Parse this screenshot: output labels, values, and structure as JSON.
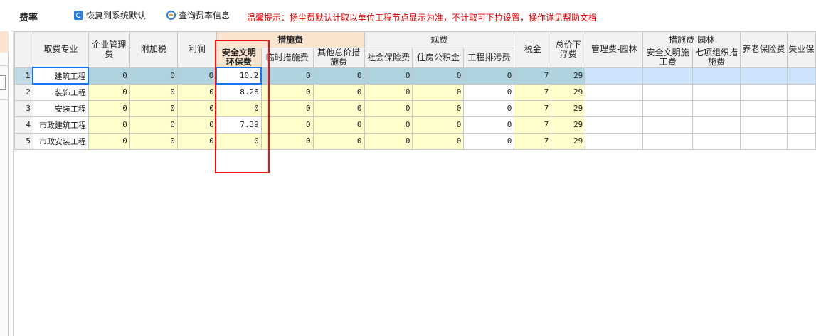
{
  "toolbar": {
    "title": "费率",
    "restore_label": "恢复到系统默认",
    "query_label": "查询费率信息",
    "tip": "温馨提示：扬尘费默认计取以单位工程节点显示为准，不计取可下拉设置，操作详见帮助文档"
  },
  "headers": {
    "profession": "取费专业",
    "mgmt": "企业管理费",
    "surtax": "附加税",
    "profit": "利润",
    "measures_group": "措施费",
    "safety": "安全文明环保费",
    "temp": "临时措施费",
    "other_total": "其他总价措施费",
    "regulation_group": "规费",
    "social": "社会保险费",
    "housing": "住房公积金",
    "sewage": "工程排污费",
    "tax": "税金",
    "float": "总价下浮费",
    "mgmt_garden": "管理费-园林",
    "garden_group": "措施费-园林",
    "safety_garden": "安全文明施工费",
    "seven_items": "七项组织措施费",
    "pension": "养老保险费",
    "unemployment": "失业保"
  },
  "rows": [
    {
      "no": "1",
      "name": "建筑工程",
      "mgmt": "0",
      "surtax": "0",
      "profit": "0",
      "safety": "10.2",
      "temp": "0",
      "other": "0",
      "social": "0",
      "housing": "0",
      "sewage": "0",
      "tax": "7",
      "float": "29"
    },
    {
      "no": "2",
      "name": "装饰工程",
      "mgmt": "0",
      "surtax": "0",
      "profit": "0",
      "safety": "8.26",
      "temp": "0",
      "other": "0",
      "social": "0",
      "housing": "0",
      "sewage": "0",
      "tax": "7",
      "float": "29"
    },
    {
      "no": "3",
      "name": "安装工程",
      "mgmt": "0",
      "surtax": "0",
      "profit": "0",
      "safety": "0",
      "temp": "0",
      "other": "0",
      "social": "0",
      "housing": "0",
      "sewage": "0",
      "tax": "7",
      "float": "29"
    },
    {
      "no": "4",
      "name": "市政建筑工程",
      "mgmt": "0",
      "surtax": "0",
      "profit": "0",
      "safety": "7.39",
      "temp": "0",
      "other": "0",
      "social": "0",
      "housing": "0",
      "sewage": "0",
      "tax": "7",
      "float": "29"
    },
    {
      "no": "5",
      "name": "市政安装工程",
      "mgmt": "0",
      "surtax": "0",
      "profit": "0",
      "safety": "0",
      "temp": "0",
      "other": "0",
      "social": "0",
      "housing": "0",
      "sewage": "0",
      "tax": "7",
      "float": "29"
    }
  ],
  "colors": {
    "highlight_header": "#fbe4cf",
    "editable_cell": "#ffffcc",
    "selected_row": "#aed3df",
    "annotation_box": "#e11111",
    "tip_text": "#e00000"
  }
}
